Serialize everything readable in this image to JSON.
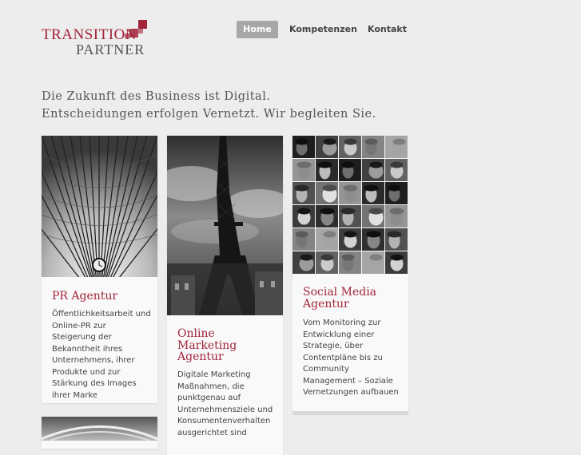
{
  "brand": {
    "line1": "TRANSITION",
    "line2": "PARTNER",
    "accent_color": "#a2243a"
  },
  "nav": {
    "items": [
      "Home",
      "Kompetenzen",
      "Kontakt"
    ],
    "active": "Home"
  },
  "hero": {
    "line1": "Die Zukunft des Business ist Digital.",
    "line2": "Entscheidungen erfolgen Vernetzt. Wir begleiten Sie."
  },
  "cards": [
    {
      "title": "PR Agentur",
      "text": "Öffentlichkeitsarbeit und Online-PR zur Steigerung der Bekanntheit ihres Unternehmens, ihrer Produkte und zur Stärkung des Images ihrer Marke",
      "image": "architecture-ceiling-clock-photo"
    },
    {
      "title": "Online Marketing Agentur",
      "text": "Digitale Marketing Maßnahmen, die punktgenau auf Unternehmensziele und Konsumentenverhalten ausgerichtet sind",
      "image": "eiffel-tower-photo"
    },
    {
      "title": "Social Media Agentur",
      "text": "Vom Monitoring zur Entwicklung einer Strategie, über Contentpläne bis zu Community Management – Soziale Vernetzungen aufbauen",
      "image": "portrait-grid-photo"
    }
  ]
}
